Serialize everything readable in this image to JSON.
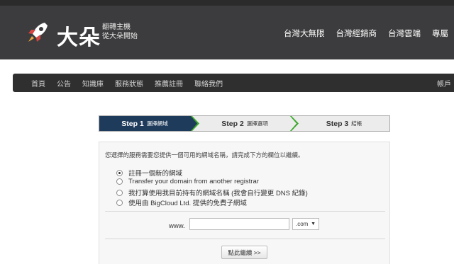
{
  "brand": {
    "name": "大朵",
    "tagline_line1": "翻轉主機",
    "tagline_line2": "從大朵開始"
  },
  "top_nav": [
    "台灣大無限",
    "台灣經銷商",
    "台灣雲端",
    "專屬"
  ],
  "main_nav": {
    "items": [
      "首頁",
      "公告",
      "知識庫",
      "服務狀態",
      "推薦註冊",
      "聯絡我們"
    ],
    "account": "帳戶"
  },
  "steps": [
    {
      "number": "Step 1",
      "label": "選擇網域",
      "active": true
    },
    {
      "number": "Step 2",
      "label": "選擇選項",
      "active": false
    },
    {
      "number": "Step 3",
      "label": "結帳",
      "active": false
    }
  ],
  "form": {
    "intro": "您選擇的服務需要您提供一個可用的網域名稱，請完成下方的欄位以繼續。",
    "options": [
      {
        "label": "註冊一個新的網域",
        "selected": true
      },
      {
        "label": "Transfer your domain from another registrar",
        "selected": false
      },
      {
        "label": "我打算使用我目前持有的網域名稱 (我會自行變更 DNS 紀錄)",
        "selected": false
      },
      {
        "label": "使用由 BigCloud Ltd. 提供的免費子網域",
        "selected": false
      }
    ],
    "www_prefix": "www.",
    "domain_value": "",
    "tld_selected": ".com",
    "continue_label": "點此繼續 >>"
  },
  "colors": {
    "header_bg": "#3c3c3e",
    "active_step": "#1f3b5c",
    "step_chevron": "#3aa72b"
  }
}
